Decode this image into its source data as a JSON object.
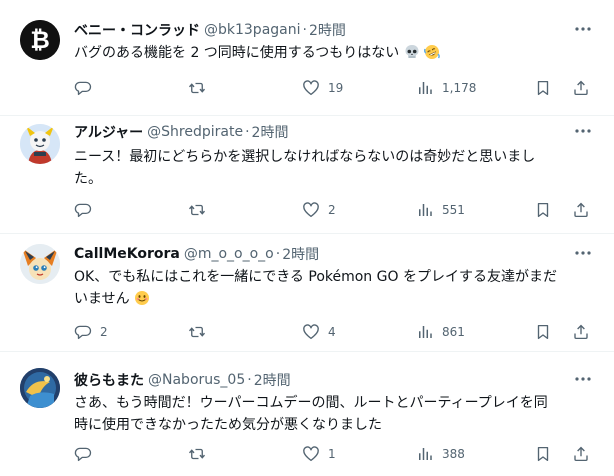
{
  "tweets": [
    {
      "name": "ベニー・コンラッド",
      "handle": "@bk13pagani",
      "sep": "·",
      "time": "2時間",
      "text": "バグのある機能を 2 つ同時に使用するつもりはない",
      "text_extra": "",
      "emojis": [
        "skull-emoji",
        "rolling-laughing-emoji"
      ],
      "avatar_icon": "bitcoin-logo-icon",
      "stats": {
        "replies": "",
        "retweets": "",
        "likes": "19",
        "views": "1,178"
      }
    },
    {
      "name": "アルジャー",
      "handle": "@Shredpirate",
      "sep": "·",
      "time": "2時間",
      "text": "ニース！最初にどちらかを選択しなければならないのは奇妙だと思いまし",
      "text_extra": "た。",
      "emojis": [],
      "avatar_icon": "pokemon-avatar",
      "stats": {
        "replies": "",
        "retweets": "",
        "likes": "2",
        "views": "551"
      }
    },
    {
      "name": "CallMeKorora",
      "handle": "@m_o_o_o_o",
      "sep": "·",
      "time": "2時間",
      "text": "OK、でも私にはこれを一緒にできる Pokémon GO をプレイする友達がまだ",
      "text_extra": "いません",
      "emojis": [
        "smiling-face-emoji"
      ],
      "avatar_icon": "victini-avatar",
      "stats": {
        "replies": "2",
        "retweets": "",
        "likes": "4",
        "views": "861"
      }
    },
    {
      "name": "彼らもまた",
      "handle": "@Naborus_05",
      "sep": "·",
      "time": "2時間",
      "text": "さあ、もう時間だ！ウーパーコムデーの間、ルートとパーティープレイを同",
      "text_extra": "時に使用できなかったため気分が悪くなりました",
      "emojis": [],
      "avatar_icon": "landscape-avatar",
      "stats": {
        "replies": "",
        "retweets": "",
        "likes": "1",
        "views": "388"
      }
    }
  ],
  "colors": {
    "text": "#0f1419",
    "secondary": "#536471",
    "divider": "#eff3f4",
    "bitcoin_bg": "#111111"
  }
}
